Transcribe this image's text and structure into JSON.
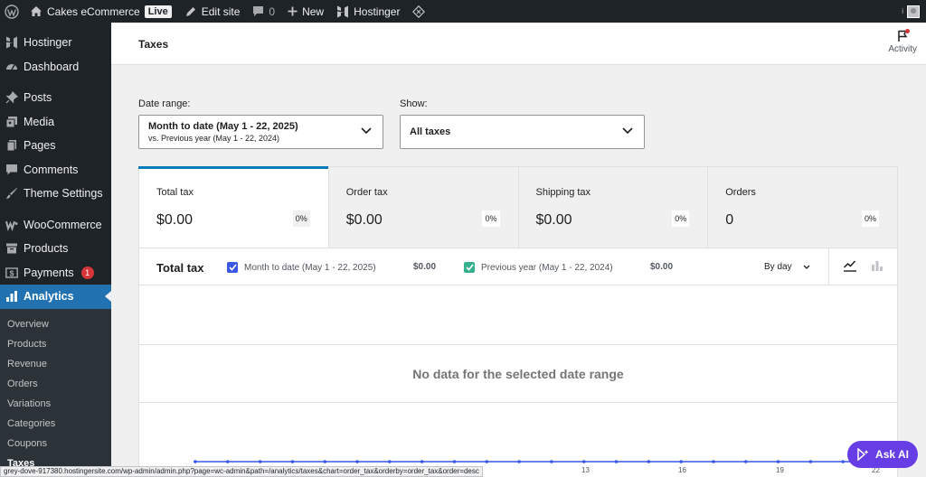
{
  "adminbar": {
    "site_name": "Cakes eCommerce",
    "live_badge": "Live",
    "edit_site": "Edit site",
    "comments_count": "0",
    "new_label": "New",
    "hostinger_label": "Hostinger"
  },
  "sidebar": {
    "items": [
      {
        "label": "Hostinger",
        "icon": "hostinger-icon"
      },
      {
        "label": "Dashboard",
        "icon": "dashboard-icon"
      },
      {
        "label": "Posts",
        "icon": "pin-icon"
      },
      {
        "label": "Media",
        "icon": "media-icon"
      },
      {
        "label": "Pages",
        "icon": "pages-icon"
      },
      {
        "label": "Comments",
        "icon": "comment-icon"
      },
      {
        "label": "Theme Settings",
        "icon": "brush-icon"
      },
      {
        "label": "WooCommerce",
        "icon": "woo-icon"
      },
      {
        "label": "Products",
        "icon": "archive-icon"
      },
      {
        "label": "Payments",
        "icon": "dollar-icon",
        "badge": "1"
      },
      {
        "label": "Analytics",
        "icon": "chart-icon"
      }
    ],
    "submenu": [
      "Overview",
      "Products",
      "Revenue",
      "Orders",
      "Variations",
      "Categories",
      "Coupons",
      "Taxes"
    ]
  },
  "header": {
    "title": "Taxes",
    "activity_label": "Activity"
  },
  "filters": {
    "date_range_label": "Date range:",
    "date_range_primary": "Month to date (May 1 - 22, 2025)",
    "date_range_secondary": "vs. Previous year (May 1 - 22, 2024)",
    "show_label": "Show:",
    "show_value": "All taxes"
  },
  "tiles": [
    {
      "label": "Total tax",
      "value": "$0.00",
      "delta": "0%"
    },
    {
      "label": "Order tax",
      "value": "$0.00",
      "delta": "0%"
    },
    {
      "label": "Shipping tax",
      "value": "$0.00",
      "delta": "0%"
    },
    {
      "label": "Orders",
      "value": "0",
      "delta": "0%"
    }
  ],
  "chart": {
    "title": "Total tax",
    "legend": [
      {
        "label": "Month to date (May 1 - 22, 2025)",
        "value": "$0.00",
        "color": "#3858e9"
      },
      {
        "label": "Previous year (May 1 - 22, 2024)",
        "value": "$0.00",
        "color": "#33b08e"
      }
    ],
    "interval": "By day",
    "empty_message": "No data for the selected date range",
    "x_ticks": [
      "13",
      "16",
      "19",
      "22"
    ]
  },
  "statusbar": {
    "url": "grey-dove-917380.hostingersite.com/wp-admin/admin.php?page=wc-admin&path=/analytics/taxes&chart=order_tax&orderby=order_tax&order=desc"
  },
  "ask_ai": {
    "label": "Ask AI"
  },
  "colors": {
    "admin_dark": "#1d2327",
    "wp_blue": "#2271b1",
    "wc_blue": "#007cba",
    "hostinger_purple": "#673de6"
  }
}
